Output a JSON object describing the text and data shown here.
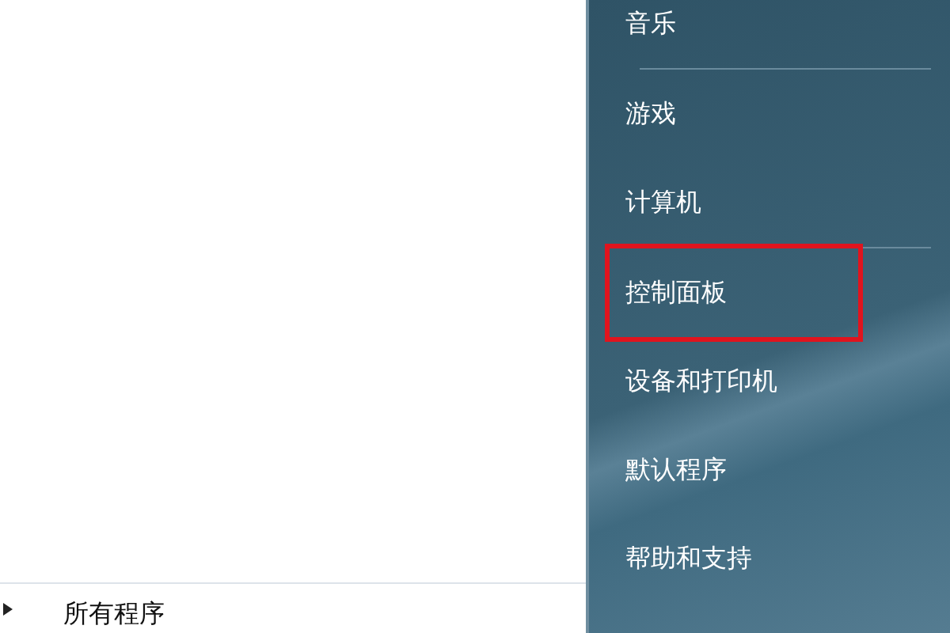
{
  "left_pane": {
    "all_programs": {
      "label": "所有程序"
    }
  },
  "right_pane": {
    "groups": [
      [
        {
          "label": "音乐",
          "highlighted": false
        }
      ],
      [
        {
          "label": "游戏",
          "highlighted": false
        },
        {
          "label": "计算机",
          "highlighted": false
        }
      ],
      [
        {
          "label": "控制面板",
          "highlighted": true
        },
        {
          "label": "设备和打印机",
          "highlighted": false
        },
        {
          "label": "默认程序",
          "highlighted": false
        },
        {
          "label": "帮助和支持",
          "highlighted": false
        }
      ]
    ]
  }
}
